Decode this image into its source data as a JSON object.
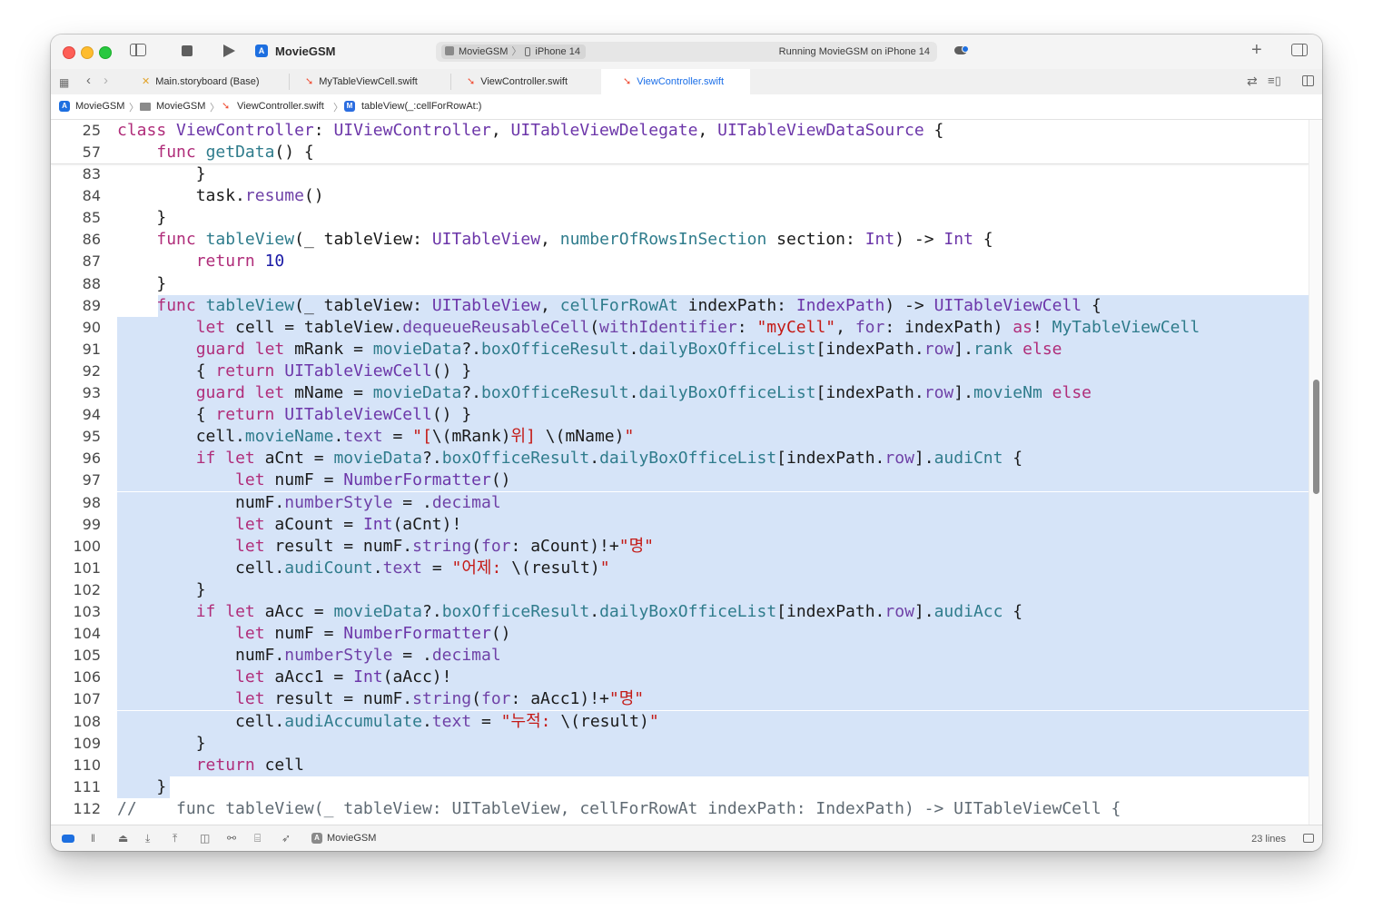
{
  "window": {
    "project_title": "MovieGSM",
    "scheme": {
      "app": "MovieGSM",
      "device": "iPhone 14"
    },
    "run_status": "Running MovieGSM on iPhone 14"
  },
  "tabs": [
    {
      "label": "Main.storyboard (Base)",
      "kind": "storyboard",
      "active": false
    },
    {
      "label": "MyTableViewCell.swift",
      "kind": "swift",
      "active": false
    },
    {
      "label": "ViewController.swift",
      "kind": "swift",
      "active": false
    },
    {
      "label": "ViewController.swift",
      "kind": "swift",
      "active": true
    }
  ],
  "jumpbar": {
    "project": "MovieGSM",
    "group": "MovieGSM",
    "file": "ViewController.swift",
    "symbol": "tableView(_:cellForRowAt:)"
  },
  "editor": {
    "sticky_lines": [
      {
        "n": "25",
        "tokens": [
          [
            "kw",
            "class"
          ],
          [
            "p",
            " "
          ],
          [
            "ty",
            "ViewController"
          ],
          [
            "p",
            ": "
          ],
          [
            "ty",
            "UIViewController"
          ],
          [
            "p",
            ", "
          ],
          [
            "ty",
            "UITableViewDelegate"
          ],
          [
            "p",
            ", "
          ],
          [
            "ty",
            "UITableViewDataSource"
          ],
          [
            "p",
            " {"
          ]
        ]
      },
      {
        "n": "57",
        "tokens": [
          [
            "p",
            "    "
          ],
          [
            "kw",
            "func"
          ],
          [
            "p",
            " "
          ],
          [
            "fn",
            "getData"
          ],
          [
            "p",
            "() {"
          ]
        ]
      }
    ],
    "lines": [
      {
        "n": "83",
        "hl": 0,
        "tokens": [
          [
            "p",
            "        }"
          ]
        ]
      },
      {
        "n": "84",
        "hl": 0,
        "tokens": [
          [
            "p",
            "        task."
          ],
          [
            "pr",
            "resume"
          ],
          [
            "p",
            "()"
          ]
        ]
      },
      {
        "n": "85",
        "hl": 0,
        "tokens": [
          [
            "p",
            "    }"
          ]
        ]
      },
      {
        "n": "86",
        "hl": 0,
        "tokens": [
          [
            "p",
            "    "
          ],
          [
            "kw",
            "func"
          ],
          [
            "p",
            " "
          ],
          [
            "fn",
            "tableView"
          ],
          [
            "p",
            "(_ tableView: "
          ],
          [
            "ty",
            "UITableView"
          ],
          [
            "p",
            ", "
          ],
          [
            "fn",
            "numberOfRowsInSection"
          ],
          [
            "p",
            " section: "
          ],
          [
            "ty",
            "Int"
          ],
          [
            "p",
            ") -> "
          ],
          [
            "ty",
            "Int"
          ],
          [
            "p",
            " {"
          ]
        ]
      },
      {
        "n": "87",
        "hl": 0,
        "tokens": [
          [
            "p",
            "        "
          ],
          [
            "kw",
            "return"
          ],
          [
            "p",
            " "
          ],
          [
            "nu",
            "10"
          ]
        ]
      },
      {
        "n": "88",
        "hl": 0,
        "tokens": [
          [
            "p",
            "    }"
          ]
        ]
      },
      {
        "n": "89",
        "hl": 1,
        "tokens": [
          [
            "p",
            "    "
          ],
          [
            "kw",
            "func"
          ],
          [
            "p",
            " "
          ],
          [
            "fn",
            "tableView"
          ],
          [
            "p",
            "(_ tableView: "
          ],
          [
            "ty",
            "UITableView"
          ],
          [
            "p",
            ", "
          ],
          [
            "fn",
            "cellForRowAt"
          ],
          [
            "p",
            " indexPath: "
          ],
          [
            "ty",
            "IndexPath"
          ],
          [
            "p",
            ") -> "
          ],
          [
            "ty",
            "UITableViewCell"
          ],
          [
            "p",
            " {"
          ]
        ]
      },
      {
        "n": "90",
        "hl": 2,
        "tokens": [
          [
            "p",
            "        "
          ],
          [
            "kw",
            "let"
          ],
          [
            "p",
            " cell = tableView."
          ],
          [
            "pr",
            "dequeueReusableCell"
          ],
          [
            "p",
            "("
          ],
          [
            "pr",
            "withIdentifier"
          ],
          [
            "p",
            ": "
          ],
          [
            "st",
            "\"myCell\""
          ],
          [
            "p",
            ", "
          ],
          [
            "pr",
            "for"
          ],
          [
            "p",
            ": indexPath) "
          ],
          [
            "kw",
            "as"
          ],
          [
            "p",
            "! "
          ],
          [
            "fn",
            "MyTableViewCell"
          ]
        ]
      },
      {
        "n": "91",
        "hl": 2,
        "tokens": [
          [
            "p",
            "        "
          ],
          [
            "kw",
            "guard"
          ],
          [
            "p",
            " "
          ],
          [
            "kw",
            "let"
          ],
          [
            "p",
            " mRank = "
          ],
          [
            "fn",
            "movieData"
          ],
          [
            "p",
            "?."
          ],
          [
            "fn",
            "boxOfficeResult"
          ],
          [
            "p",
            "."
          ],
          [
            "fn",
            "dailyBoxOfficeList"
          ],
          [
            "p",
            "[indexPath."
          ],
          [
            "pr",
            "row"
          ],
          [
            "p",
            "]."
          ],
          [
            "fn",
            "rank"
          ],
          [
            "p",
            " "
          ],
          [
            "kw",
            "else"
          ]
        ]
      },
      {
        "n": "92",
        "hl": 2,
        "tokens": [
          [
            "p",
            "        { "
          ],
          [
            "kw",
            "return"
          ],
          [
            "p",
            " "
          ],
          [
            "ty",
            "UITableViewCell"
          ],
          [
            "p",
            "() }"
          ]
        ]
      },
      {
        "n": "93",
        "hl": 2,
        "tokens": [
          [
            "p",
            "        "
          ],
          [
            "kw",
            "guard"
          ],
          [
            "p",
            " "
          ],
          [
            "kw",
            "let"
          ],
          [
            "p",
            " mName = "
          ],
          [
            "fn",
            "movieData"
          ],
          [
            "p",
            "?."
          ],
          [
            "fn",
            "boxOfficeResult"
          ],
          [
            "p",
            "."
          ],
          [
            "fn",
            "dailyBoxOfficeList"
          ],
          [
            "p",
            "[indexPath."
          ],
          [
            "pr",
            "row"
          ],
          [
            "p",
            "]."
          ],
          [
            "fn",
            "movieNm"
          ],
          [
            "p",
            " "
          ],
          [
            "kw",
            "else"
          ]
        ]
      },
      {
        "n": "94",
        "hl": 2,
        "tokens": [
          [
            "p",
            "        { "
          ],
          [
            "kw",
            "return"
          ],
          [
            "p",
            " "
          ],
          [
            "ty",
            "UITableViewCell"
          ],
          [
            "p",
            "() }"
          ]
        ]
      },
      {
        "n": "95",
        "hl": 2,
        "tokens": [
          [
            "p",
            "        cell."
          ],
          [
            "fn",
            "movieName"
          ],
          [
            "p",
            "."
          ],
          [
            "pr",
            "text"
          ],
          [
            "p",
            " = "
          ],
          [
            "st",
            "\"["
          ],
          [
            "p",
            "\\(mRank)"
          ],
          [
            "st",
            "위] "
          ],
          [
            "p",
            "\\(mName)"
          ],
          [
            "st",
            "\""
          ]
        ]
      },
      {
        "n": "96",
        "hl": 2,
        "tokens": [
          [
            "p",
            "        "
          ],
          [
            "kw",
            "if"
          ],
          [
            "p",
            " "
          ],
          [
            "kw",
            "let"
          ],
          [
            "p",
            " aCnt = "
          ],
          [
            "fn",
            "movieData"
          ],
          [
            "p",
            "?."
          ],
          [
            "fn",
            "boxOfficeResult"
          ],
          [
            "p",
            "."
          ],
          [
            "fn",
            "dailyBoxOfficeList"
          ],
          [
            "p",
            "[indexPath."
          ],
          [
            "pr",
            "row"
          ],
          [
            "p",
            "]."
          ],
          [
            "fn",
            "audiCnt"
          ],
          [
            "p",
            " {"
          ]
        ]
      },
      {
        "n": "97",
        "hl": 2,
        "tokens": [
          [
            "p",
            "            "
          ],
          [
            "kw",
            "let"
          ],
          [
            "p",
            " numF = "
          ],
          [
            "ty",
            "NumberFormatter"
          ],
          [
            "p",
            "()"
          ]
        ]
      },
      {
        "n": "98",
        "hl": 2,
        "tokens": [
          [
            "p",
            "            numF."
          ],
          [
            "pr",
            "numberStyle"
          ],
          [
            "p",
            " = ."
          ],
          [
            "pr",
            "decimal"
          ]
        ]
      },
      {
        "n": "99",
        "hl": 2,
        "tokens": [
          [
            "p",
            "            "
          ],
          [
            "kw",
            "let"
          ],
          [
            "p",
            " aCount = "
          ],
          [
            "ty",
            "Int"
          ],
          [
            "p",
            "(aCnt)!"
          ]
        ]
      },
      {
        "n": "100",
        "hl": 2,
        "tokens": [
          [
            "p",
            "            "
          ],
          [
            "kw",
            "let"
          ],
          [
            "p",
            " result = numF."
          ],
          [
            "pr",
            "string"
          ],
          [
            "p",
            "("
          ],
          [
            "pr",
            "for"
          ],
          [
            "p",
            ": aCount)!+"
          ],
          [
            "st",
            "\"명\""
          ]
        ]
      },
      {
        "n": "101",
        "hl": 2,
        "tokens": [
          [
            "p",
            "            cell."
          ],
          [
            "fn",
            "audiCount"
          ],
          [
            "p",
            "."
          ],
          [
            "pr",
            "text"
          ],
          [
            "p",
            " = "
          ],
          [
            "st",
            "\"어제: "
          ],
          [
            "p",
            "\\(result)"
          ],
          [
            "st",
            "\""
          ]
        ]
      },
      {
        "n": "102",
        "hl": 2,
        "tokens": [
          [
            "p",
            "        }"
          ]
        ]
      },
      {
        "n": "103",
        "hl": 2,
        "tokens": [
          [
            "p",
            "        "
          ],
          [
            "kw",
            "if"
          ],
          [
            "p",
            " "
          ],
          [
            "kw",
            "let"
          ],
          [
            "p",
            " aAcc = "
          ],
          [
            "fn",
            "movieData"
          ],
          [
            "p",
            "?."
          ],
          [
            "fn",
            "boxOfficeResult"
          ],
          [
            "p",
            "."
          ],
          [
            "fn",
            "dailyBoxOfficeList"
          ],
          [
            "p",
            "[indexPath."
          ],
          [
            "pr",
            "row"
          ],
          [
            "p",
            "]."
          ],
          [
            "fn",
            "audiAcc"
          ],
          [
            "p",
            " {"
          ]
        ]
      },
      {
        "n": "104",
        "hl": 2,
        "tokens": [
          [
            "p",
            "            "
          ],
          [
            "kw",
            "let"
          ],
          [
            "p",
            " numF = "
          ],
          [
            "ty",
            "NumberFormatter"
          ],
          [
            "p",
            "()"
          ]
        ]
      },
      {
        "n": "105",
        "hl": 2,
        "tokens": [
          [
            "p",
            "            numF."
          ],
          [
            "pr",
            "numberStyle"
          ],
          [
            "p",
            " = ."
          ],
          [
            "pr",
            "decimal"
          ]
        ]
      },
      {
        "n": "106",
        "hl": 2,
        "tokens": [
          [
            "p",
            "            "
          ],
          [
            "kw",
            "let"
          ],
          [
            "p",
            " aAcc1 = "
          ],
          [
            "ty",
            "Int"
          ],
          [
            "p",
            "(aAcc)!"
          ]
        ]
      },
      {
        "n": "107",
        "hl": 2,
        "tokens": [
          [
            "p",
            "            "
          ],
          [
            "kw",
            "let"
          ],
          [
            "p",
            " result = numF."
          ],
          [
            "pr",
            "string"
          ],
          [
            "p",
            "("
          ],
          [
            "pr",
            "for"
          ],
          [
            "p",
            ": aAcc1)!+"
          ],
          [
            "st",
            "\"명\""
          ]
        ]
      },
      {
        "n": "108",
        "hl": 2,
        "tokens": [
          [
            "p",
            "            cell."
          ],
          [
            "fn",
            "audiAccumulate"
          ],
          [
            "p",
            "."
          ],
          [
            "pr",
            "text"
          ],
          [
            "p",
            " = "
          ],
          [
            "st",
            "\"누적: "
          ],
          [
            "p",
            "\\(result)"
          ],
          [
            "st",
            "\""
          ]
        ]
      },
      {
        "n": "109",
        "hl": 2,
        "tokens": [
          [
            "p",
            "        }"
          ]
        ]
      },
      {
        "n": "110",
        "hl": 2,
        "tokens": [
          [
            "p",
            "        "
          ],
          [
            "kw",
            "return"
          ],
          [
            "p",
            " cell"
          ]
        ]
      },
      {
        "n": "111",
        "hl": 3,
        "tokens": [
          [
            "p",
            "    }"
          ]
        ]
      },
      {
        "n": "112",
        "hl": 0,
        "tokens": [
          [
            "cm",
            "//    func tableView(_ tableView: UITableView, cellForRowAt indexPath: IndexPath) -> UITableViewCell {"
          ]
        ]
      }
    ]
  },
  "statusbar": {
    "scheme": "MovieGSM",
    "selection": "23 lines"
  },
  "colors": {
    "selection": "#d6e4f8",
    "keyword": "#b02d7a",
    "type": "#6c36a9",
    "function": "#2f7c8c",
    "string": "#c41a16",
    "number": "#1a1aa6"
  }
}
